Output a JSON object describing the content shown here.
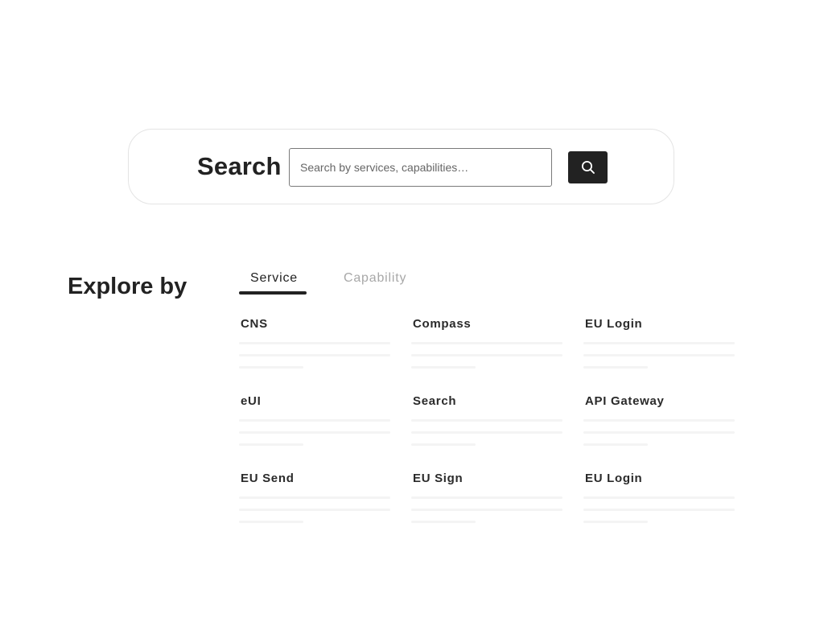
{
  "search": {
    "title": "Search",
    "placeholder": "Search by services, capabilities…",
    "button_icon": "search-icon"
  },
  "explore": {
    "title": "Explore by",
    "tabs": [
      {
        "label": "Service",
        "active": true
      },
      {
        "label": "Capability",
        "active": false
      }
    ],
    "items": [
      {
        "label": "CNS"
      },
      {
        "label": "Compass"
      },
      {
        "label": "EU Login"
      },
      {
        "label": "eUI"
      },
      {
        "label": "Search"
      },
      {
        "label": "API Gateway"
      },
      {
        "label": "EU Send"
      },
      {
        "label": "EU Sign"
      },
      {
        "label": "EU Login"
      }
    ]
  },
  "colors": {
    "primary": "#222222",
    "inactive_tab": "#a8a8a8",
    "panel_border": "#e4e4e4",
    "skeleton": "#f4f4f4"
  }
}
